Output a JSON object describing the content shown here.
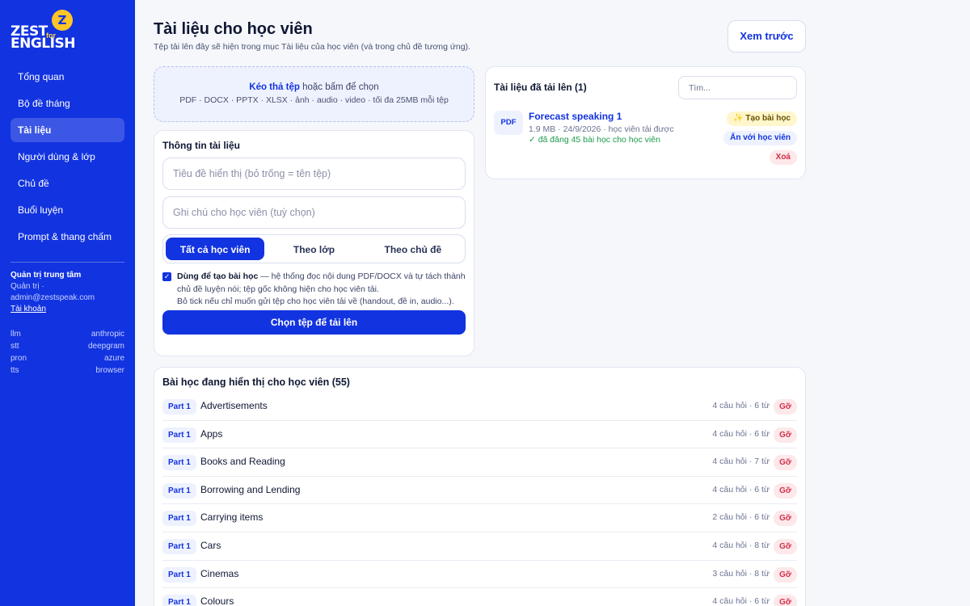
{
  "logo": {
    "word1": "ZEST",
    "word2": "ENGLISH",
    "for": "for",
    "z": "Z"
  },
  "sidebar": {
    "items": [
      {
        "label": "Tổng quan",
        "active": false
      },
      {
        "label": "Bộ đề tháng",
        "active": false
      },
      {
        "label": "Tài liệu",
        "active": true
      },
      {
        "label": "Người dùng & lớp",
        "active": false
      },
      {
        "label": "Chủ đề",
        "active": false
      },
      {
        "label": "Buổi luyện",
        "active": false
      },
      {
        "label": "Prompt & thang chấm",
        "active": false
      }
    ],
    "account": {
      "title": "Quản trị trung tâm",
      "role": "Quản trị ·",
      "email": "admin@zestspeak.com",
      "link": "Tài khoản"
    },
    "providers": [
      {
        "key": "llm",
        "value": "anthropic"
      },
      {
        "key": "stt",
        "value": "deepgram"
      },
      {
        "key": "pron",
        "value": "azure"
      },
      {
        "key": "tts",
        "value": "browser"
      }
    ]
  },
  "header": {
    "title": "Tài liệu cho học viên",
    "subtitle": "Tệp tải lên đây sẽ hiện trong mục Tài liệu của học viên (và trong chủ đề tương ứng).",
    "preview_label": "Xem trước"
  },
  "dropzone": {
    "strong": "Kéo thả tệp",
    "rest": " hoặc bấm để chọn",
    "formats": "PDF · DOCX · PPTX · XLSX · ảnh · audio · video · tối đa 25MB mỗi tệp"
  },
  "info": {
    "title": "Thông tin tài liệu",
    "title_placeholder": "Tiêu đề hiển thị (bỏ trống = tên tệp)",
    "note_placeholder": "Ghi chú cho học viên (tuỳ chọn)",
    "segments": [
      {
        "label": "Tất cả học viên",
        "active": true
      },
      {
        "label": "Theo lớp",
        "active": false
      },
      {
        "label": "Theo chủ đề",
        "active": false
      }
    ],
    "checkbox_strong": "Dùng để tạo bài học",
    "checkbox_text": " — hệ thống đọc nội dung PDF/DOCX và tự tách thành chủ đề luyện nói; tệp gốc không hiện cho học viên tải.",
    "checkbox_text2": "Bỏ tick nếu chỉ muốn gửi tệp cho học viên tải về (handout, đề in, audio...).",
    "upload_button": "Chọn tệp để tải lên"
  },
  "uploads": {
    "title": "Tài liệu đã tải lên (1)",
    "search_placeholder": "Tìm...",
    "file": {
      "badge": "PDF",
      "name": "Forecast speaking 1",
      "meta": "1.9 MB · 24/9/2026 · học viên tải được",
      "status": "✓ đã đăng 45 bài học cho học viên",
      "create_label": "✨ Tạo bài học",
      "hide_label": "Ẩn với học viên",
      "delete_label": "Xoá"
    }
  },
  "lessons": {
    "title": "Bài học đang hiển thị cho học viên (55)",
    "remove_label": "Gỡ",
    "rows": [
      {
        "part": "Part 1",
        "name": "Advertisements",
        "meta": "4 câu hỏi · 6 từ"
      },
      {
        "part": "Part 1",
        "name": "Apps",
        "meta": "4 câu hỏi · 6 từ"
      },
      {
        "part": "Part 1",
        "name": "Books and Reading",
        "meta": "4 câu hỏi · 7 từ"
      },
      {
        "part": "Part 1",
        "name": "Borrowing and Lending",
        "meta": "4 câu hỏi · 6 từ"
      },
      {
        "part": "Part 1",
        "name": "Carrying items",
        "meta": "2 câu hỏi · 6 từ"
      },
      {
        "part": "Part 1",
        "name": "Cars",
        "meta": "4 câu hỏi · 8 từ"
      },
      {
        "part": "Part 1",
        "name": "Cinemas",
        "meta": "3 câu hỏi · 8 từ"
      },
      {
        "part": "Part 1",
        "name": "Colours",
        "meta": "4 câu hỏi · 6 từ"
      }
    ]
  },
  "colors": {
    "brand": "#1233e0",
    "accent": "#ffc628",
    "danger": "#d32f4a",
    "success": "#1c9a4a"
  }
}
